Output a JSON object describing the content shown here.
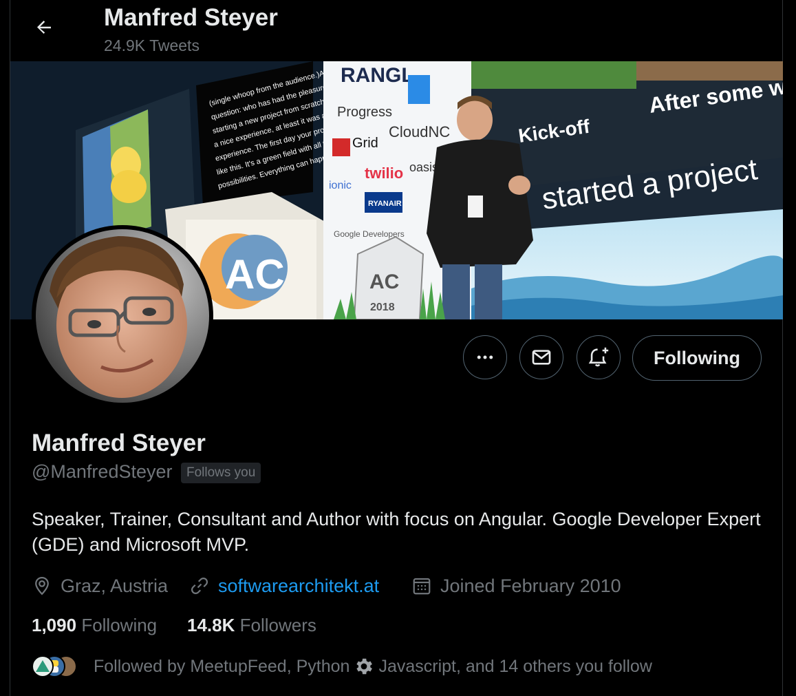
{
  "header": {
    "name": "Manfred Steyer",
    "tweet_count": "24.9K Tweets"
  },
  "banner": {
    "slide_text_1": "Kick-off",
    "slide_text_2": "After some w",
    "slide_text_3": "started a project",
    "podium_logo": "AC",
    "sponsors": [
      "RANGL",
      "Progress",
      "agGrid",
      "CloudNC",
      "ionic",
      "twilio",
      "oasis",
      "RYANAIR",
      "Google Developers"
    ],
    "badge_year": "2018",
    "screen_quote": "(single whoop from the audience. )A question: who has had the pleasure of starting a new project from scratch? Nice. It's a nice experience, at least it was a nice experience. The first day your project looks like this. It's a green field with all those possibilities. Everything can happen here. Then"
  },
  "actions": {
    "more_icon": "more-icon",
    "message_icon": "envelope-icon",
    "notify_icon": "bell-plus-icon",
    "following_label": "Following"
  },
  "profile": {
    "name": "Manfred Steyer",
    "handle": "@ManfredSteyer",
    "follows_you": "Follows you",
    "bio": "Speaker, Trainer, Consultant and Author with focus on Angular. Google Developer Expert (GDE) and Microsoft MVP.",
    "location": "Graz, Austria",
    "website": "softwarearchitekt.at",
    "joined": "Joined February 2010",
    "following_count": "1,090",
    "following_label": "Following",
    "followers_count": "14.8K",
    "followers_label": "Followers",
    "followed_by_prefix": "Followed by MeetupFeed, Python",
    "followed_by_suffix": "Javascript, and 14 others you follow"
  },
  "colors": {
    "background": "#000000",
    "text_primary": "#e7e9ea",
    "text_secondary": "#71767b",
    "link": "#1d9bf0",
    "border": "#536471"
  }
}
